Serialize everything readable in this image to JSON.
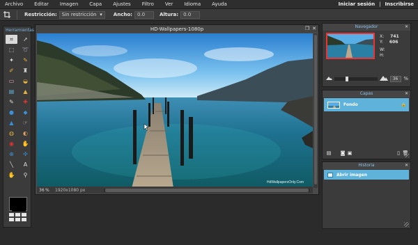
{
  "menubar": {
    "items": [
      "Archivo",
      "Editar",
      "Imagen",
      "Capa",
      "Ajustes",
      "Filtro",
      "Ver",
      "Idioma",
      "Ayuda"
    ],
    "login": "Iniciar sesión",
    "separator": "|",
    "register": "Inscribirse"
  },
  "options": {
    "restriction_label": "Restricción:",
    "restriction_value": "Sin restricción",
    "width_label": "Ancho:",
    "width_value": "0.0",
    "height_label": "Altura:",
    "height_value": "0.0"
  },
  "tools": {
    "title": "Herramientas",
    "icons": [
      "crop-icon",
      "move-icon",
      "marquee-icon",
      "lasso-icon",
      "wand-icon",
      "pencil-icon",
      "brush-icon",
      "clone-stamp-icon",
      "eraser-icon",
      "bucket-icon",
      "gradient-icon",
      "stamp-icon",
      "color-replace-icon",
      "spot-heal-icon",
      "drop-icon",
      "blur-icon",
      "sharpen-icon",
      "smudge-icon",
      "sponge-icon",
      "dodge-icon",
      "red-eye-icon",
      "burn-icon",
      "bloat-icon",
      "pinch-icon",
      "picker-icon",
      "text-icon",
      "hand-icon",
      "zoom-icon"
    ],
    "foreground_color": "#000000",
    "background_color": "#000000"
  },
  "canvas": {
    "title": "HD-Wallpapers-1080p",
    "zoom": "36",
    "zoom_unit": "%",
    "dimensions": "1920x1080 px",
    "watermark": "HdWallpapersOnly.Com"
  },
  "navigator": {
    "title": "Navegador",
    "x_label": "X:",
    "x_value": "741",
    "y_label": "Y:",
    "y_value": "606",
    "w_label": "W:",
    "w_value": "",
    "h_label": "H:",
    "h_value": "",
    "zoom_value": "36",
    "zoom_unit": "%"
  },
  "layers": {
    "title": "Capas",
    "items": [
      {
        "name": "Fondo"
      }
    ]
  },
  "history": {
    "title": "Historia",
    "items": [
      {
        "name": "Abrir imagen"
      }
    ]
  },
  "colors": {
    "accent": "#5fb3da",
    "panel_title": "#8cc1ea"
  }
}
